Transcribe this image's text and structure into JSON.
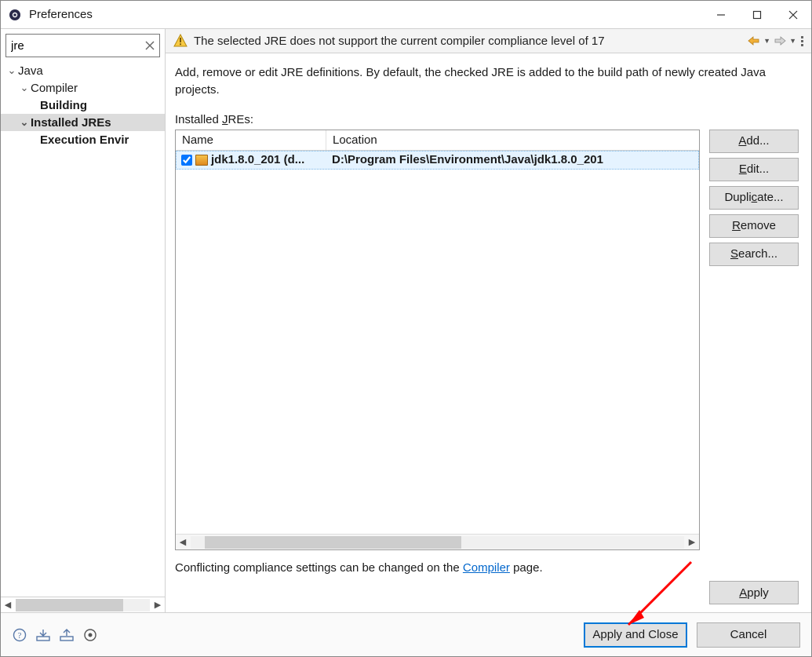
{
  "window": {
    "title": "Preferences"
  },
  "search": {
    "value": "jre"
  },
  "tree": {
    "n0": "Java",
    "n1": "Compiler",
    "n2": "Building",
    "n3": "Installed JREs",
    "n4": "Execution Envir"
  },
  "banner": {
    "text": "The selected JRE does not support the current compiler compliance level of 17"
  },
  "desc": "Add, remove or edit JRE definitions. By default, the checked JRE is added to the build path of newly created Java projects.",
  "jre": {
    "label_pre": "Installed ",
    "label_ul": "J",
    "label_post": "REs:",
    "col_name": "Name",
    "col_loc": "Location",
    "rows": [
      {
        "checked": true,
        "name": "jdk1.8.0_201 (d...",
        "loc": "D:\\Program Files\\Environment\\Java\\jdk1.8.0_201"
      }
    ]
  },
  "buttons": {
    "add_pre": "",
    "add_ul": "A",
    "add_post": "dd...",
    "edit_pre": "",
    "edit_ul": "E",
    "edit_post": "dit...",
    "dup_pre": "Dupli",
    "dup_ul": "c",
    "dup_post": "ate...",
    "rem_pre": "",
    "rem_ul": "R",
    "rem_post": "emove",
    "search_pre": "",
    "search_ul": "S",
    "search_post": "earch...",
    "apply_pre": "",
    "apply_ul": "A",
    "apply_post": "pply",
    "apply_close": "Apply and Close",
    "cancel": "Cancel"
  },
  "compliance": {
    "pre": "Conflicting compliance settings can be changed on the ",
    "link": "Compiler",
    "post": " page."
  }
}
